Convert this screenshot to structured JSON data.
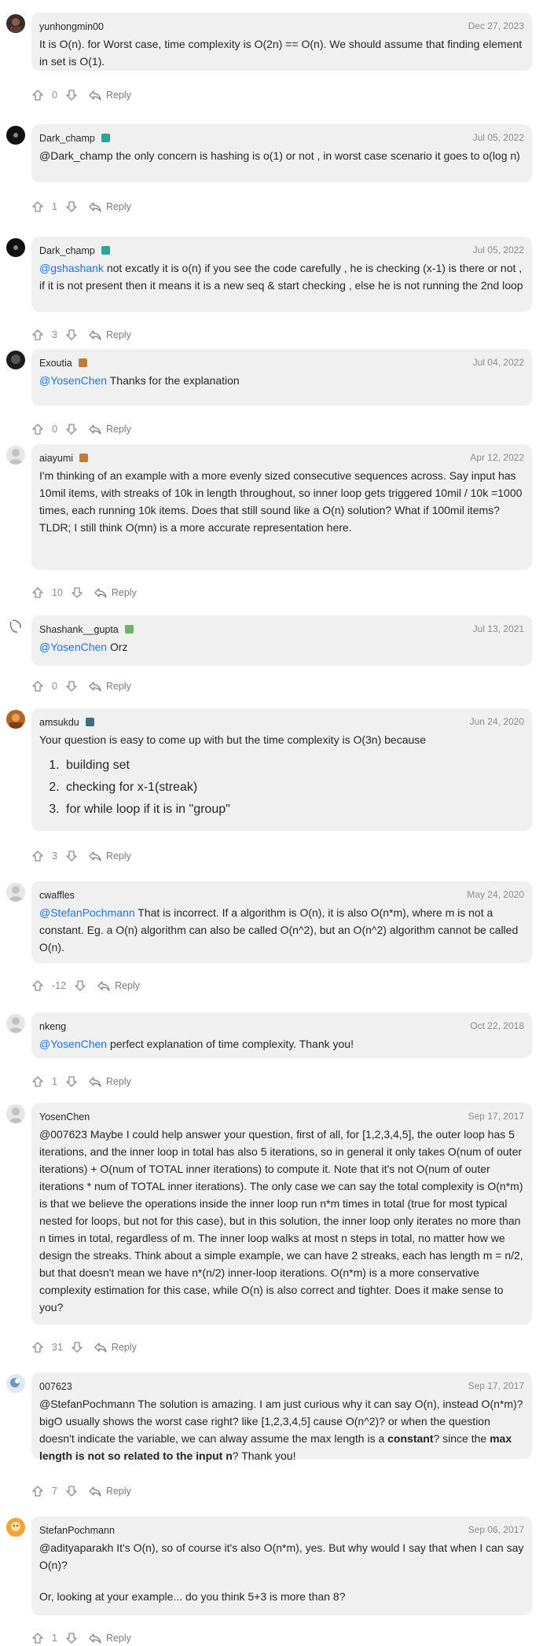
{
  "reply_label": "Reply",
  "comments": [
    {
      "user": "yunhongmin00",
      "date": "Dec 27, 2023",
      "badge": "",
      "votes": "0",
      "html": "It is O(n). for Worst case, time complexity is O(2n) == O(n). We should assume that finding element in set is O(1)."
    },
    {
      "user": "Dark_champ",
      "date": "Jul 05, 2022",
      "badge": "#2ba59a",
      "votes": "1",
      "html": "@Dark_champ the only concern is hashing is o(1) or not , in worst case scenario it goes to o(log n)"
    },
    {
      "user": "Dark_champ",
      "date": "Jul 05, 2022",
      "badge": "#2ba59a",
      "votes": "3",
      "html": "<span class=\"mention\">@gshashank</span> not excatly it is o(n) if you see the code carefully , he is checking (x-1) is there or not , if it is not present then it means it is a new seq &amp; start checking , else he is not running the 2nd loop"
    },
    {
      "user": "Exoutia",
      "date": "Jul 04, 2022",
      "badge": "#c07a3a",
      "votes": "0",
      "html": "<span class=\"mention\">@YosenChen</span> Thanks for the explanation"
    },
    {
      "user": "aiayumi",
      "date": "Apr 12, 2022",
      "badge": "#c07a3a",
      "votes": "10",
      "html": "I'm thinking of an example with a more evenly sized consecutive sequences across. Say input has 10mil items, with streaks of 10k in length throughout, so inner loop gets triggered 10mil / 10k =1000 times, each running 10k items. Does that still sound like a O(n) solution? What if 100mil items?<br>TLDR; I still think O(mn) is a more accurate representation here."
    },
    {
      "user": "Shashank__gupta",
      "date": "Jul 13, 2021",
      "badge": "#6fb36a",
      "votes": "0",
      "html": "<span class=\"mention\">@YosenChen</span> Orz"
    },
    {
      "user": "amsukdu",
      "date": "Jun 24, 2020",
      "badge": "#3f6f7a",
      "votes": "3",
      "html": "Your question is easy to come up with but the time complexity is O(3n) because",
      "list": [
        "building set",
        "checking for x-1(streak)",
        "for while loop if it is in \"group\""
      ]
    },
    {
      "user": "cwaffles",
      "date": "May 24, 2020",
      "badge": "",
      "votes": "-12",
      "html": "<span class=\"mention\">@StefanPochmann</span> That is incorrect. If a algorithm is O(n), it is also O(n*m), where m is not a constant. Eg. a O(n) algorithm can also be called O(n^2), but an O(n^2) algorithm cannot be called O(n)."
    },
    {
      "user": "nkeng",
      "date": "Oct 22, 2018",
      "badge": "",
      "votes": "1",
      "html": "<span class=\"mention\">@YosenChen</span> perfect explanation of time complexity. Thank you!"
    },
    {
      "user": "YosenChen",
      "date": "Sep 17, 2017",
      "badge": "",
      "votes": "31",
      "html": "@007623 Maybe I could help answer your question, first of all, for [1,2,3,4,5], the outer loop has 5 iterations, and the inner loop in total has also 5 iterations, so in general it only takes O(num of outer iterations) + O(num of TOTAL inner iterations) to compute it. Note that it's not O(num of outer iterations * num of TOTAL inner iterations). The only case we can say the total complexity is O(n*m) is that we believe the operations inside the inner loop run n*m times in total (true for most typical nested for loops, but not for this case), but in this solution, the inner loop only iterates no more than n times in total, regardless of m. The inner loop walks at most n steps in total, no matter how we design the streaks. Think about a simple example, we can have 2 streaks, each has length m = n/2, but that doesn't mean we have n*(n/2) inner-loop iterations. O(n*m) is a more conservative complexity estimation for this case, while O(n) is also correct and tighter. Does it make sense to you?"
    },
    {
      "user": "007623",
      "date": "Sep 17, 2017",
      "badge": "",
      "votes": "7",
      "html": "@StefanPochmann The solution is amazing. I am just curious why it can say O(n), instead O(n*m)? bigO usually shows the worst case right? like [1,2,3,4,5] cause O(n^2)? or when the question doesn't indicate the variable, we can alway assume the max length is a <b>constant</b>? since the <b>max length is not so related to the input n</b>? Thank you!"
    },
    {
      "user": "StefanPochmann",
      "date": "Sep 06, 2017",
      "badge": "",
      "votes": "1",
      "html": "@adityaparakh It's O(n), so of course it's also O(n*m), yes. But why would I say that when I can say O(n)?",
      "para2": "Or, looking at your example... do you think 5+3 is more than 8?"
    }
  ]
}
